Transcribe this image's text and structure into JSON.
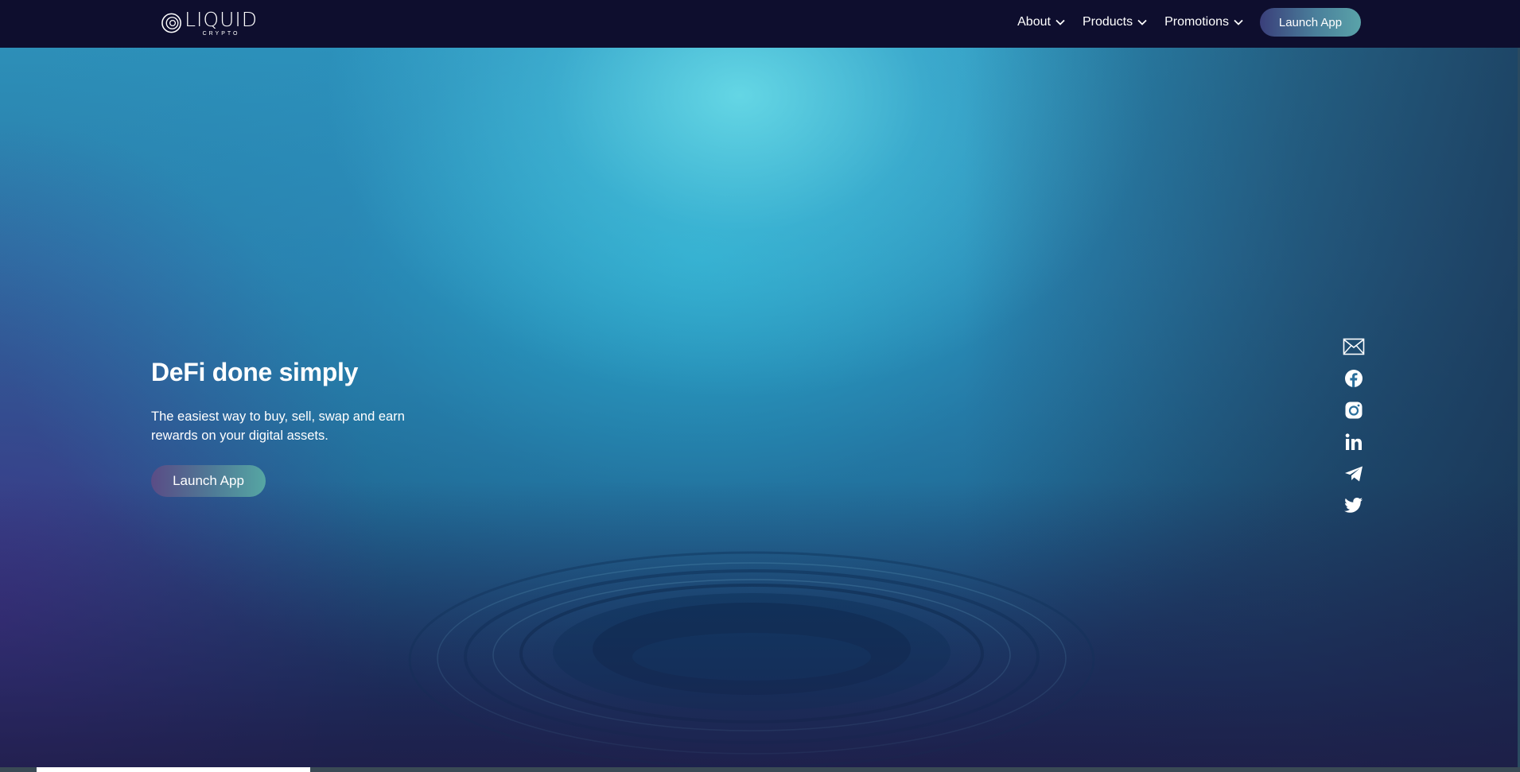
{
  "logo": {
    "word": "LIQUID",
    "sub": "CRYPTO"
  },
  "nav": {
    "items": [
      {
        "label": "About"
      },
      {
        "label": "Products"
      },
      {
        "label": "Promotions"
      }
    ],
    "launch_label": "Launch App"
  },
  "hero": {
    "title": "DeFi done simply",
    "subtitle": "The easiest way to buy, sell, swap and earn rewards on your digital assets.",
    "launch_label": "Launch App"
  },
  "social": [
    "mail-icon",
    "facebook-icon",
    "instagram-icon",
    "linkedin-icon",
    "telegram-icon",
    "twitter-icon"
  ],
  "colors": {
    "nav_bg": "#0e0e2e",
    "accent_start": "#3a3f7a",
    "accent_end": "#5aa3a9",
    "text": "#ffffff"
  }
}
